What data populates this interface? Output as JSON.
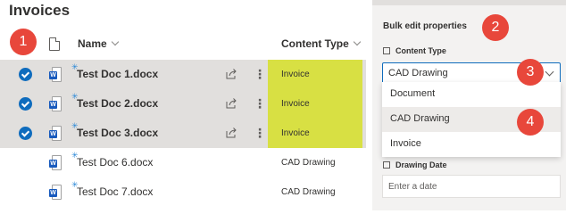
{
  "library": {
    "title": "Invoices"
  },
  "columns": {
    "name": "Name",
    "content_type": "Content Type"
  },
  "rows": [
    {
      "name": "Test Doc 1.docx",
      "content_type": "Invoice",
      "selected": true
    },
    {
      "name": "Test Doc 2.docx",
      "content_type": "Invoice",
      "selected": true
    },
    {
      "name": "Test Doc 3.docx",
      "content_type": "Invoice",
      "selected": true
    },
    {
      "name": "Test Doc 6.docx",
      "content_type": "CAD Drawing",
      "selected": false
    },
    {
      "name": "Test Doc 7.docx",
      "content_type": "CAD Drawing",
      "selected": false
    }
  ],
  "panel": {
    "title": "Bulk edit properties",
    "content_type_label": "Content Type",
    "content_type_value": "CAD Drawing",
    "options": [
      "Document",
      "CAD Drawing",
      "Invoice"
    ],
    "drawing_date_label": "Drawing Date",
    "drawing_date_placeholder": "Enter a date"
  },
  "callouts": [
    "1",
    "2",
    "3",
    "4"
  ],
  "icons": {
    "row_check": "checkmark-circle-icon",
    "file": "word-document-icon",
    "share": "share-icon",
    "more": "more-vertical-icon",
    "content_type_field": "content-type-icon",
    "date_field": "calendar-icon"
  },
  "colors": {
    "highlight": "#d8e043",
    "callout": "#e8473b",
    "accent": "#0f6cbd",
    "selected_row": "#e1dfdd"
  },
  "glyphs": {
    "word_badge": "W",
    "new_mark": "✳",
    "more": "⋮"
  }
}
